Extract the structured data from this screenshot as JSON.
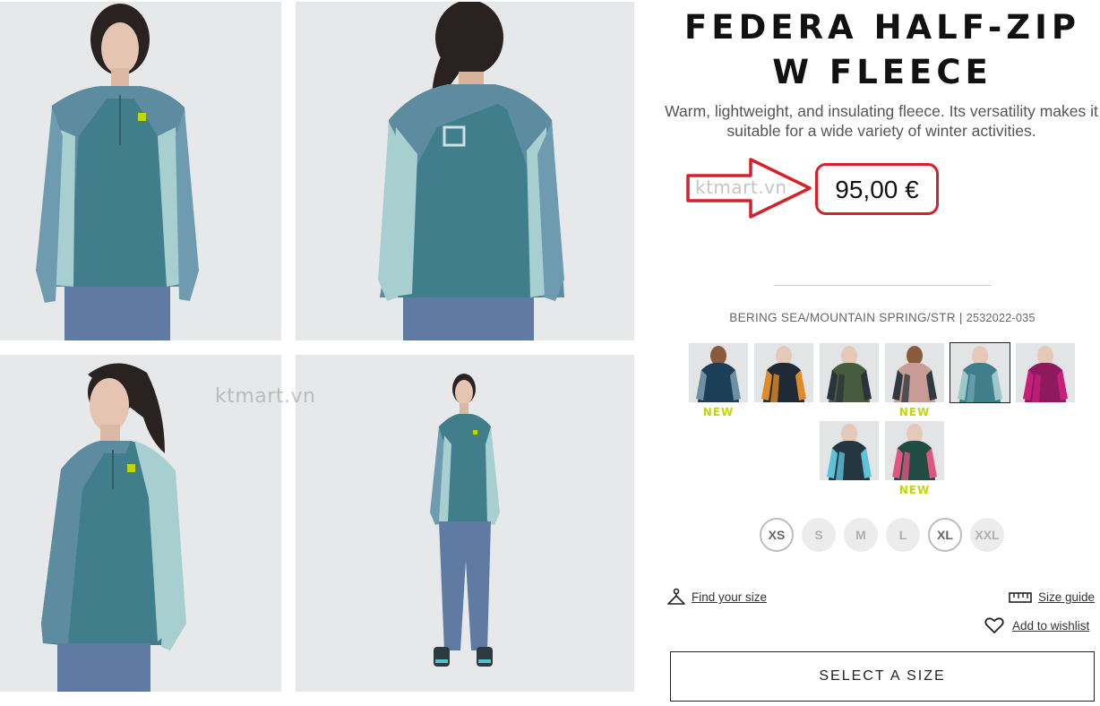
{
  "product": {
    "title": "FEDERA HALF-ZIP W FLEECE",
    "description": "Warm, lightweight, and insulating fleece. Its versatility makes it suitable for a wide variety of winter activities.",
    "price": "95,00 €",
    "variant_name": "BERING SEA/MOUNTAIN SPRING/STR |",
    "variant_code": "2532022-035"
  },
  "watermark": "ktmart.vn",
  "gallery": [
    {
      "view": "front"
    },
    {
      "view": "back"
    },
    {
      "view": "three-quarter"
    },
    {
      "view": "full-body"
    }
  ],
  "colors": {
    "swatches": [
      {
        "top": "#1c3f58",
        "side": "#6f8fa3",
        "accent": "#1c3f58",
        "skin": "#8a5a3c",
        "new": true
      },
      {
        "top": "#1e2b36",
        "side": "#e08a26",
        "accent": "#e08a26",
        "skin": "#e4c9b8",
        "new": false
      },
      {
        "top": "#465c3c",
        "side": "#2a333a",
        "accent": "#2a333a",
        "skin": "#e4c9b8",
        "new": false
      },
      {
        "top": "#c99b95",
        "side": "#2f3a40",
        "accent": "#2f3a40",
        "skin": "#8a5a3c",
        "new": true
      },
      {
        "top": "#3f7e8a",
        "side": "#9fc7c8",
        "accent": "#6ea2b2",
        "skin": "#e4c9b8",
        "new": false,
        "selected": true
      },
      {
        "top": "#8e1a5e",
        "side": "#c81f7a",
        "accent": "#c81f7a",
        "skin": "#e4c9b8",
        "new": false
      },
      {
        "top": "#253640",
        "side": "#5ec3d8",
        "accent": "#5ec3d8",
        "skin": "#e4c9b8",
        "new": false
      },
      {
        "top": "#1f4d43",
        "side": "#e0557f",
        "accent": "#e0557f",
        "skin": "#e4c9b8",
        "new": true
      }
    ],
    "new_label": "NEW",
    "new_color": "#c3d600"
  },
  "sizes": [
    {
      "label": "XS",
      "available": true
    },
    {
      "label": "S",
      "available": false
    },
    {
      "label": "M",
      "available": false
    },
    {
      "label": "L",
      "available": false
    },
    {
      "label": "XL",
      "available": true
    },
    {
      "label": "XXL",
      "available": false
    }
  ],
  "links": {
    "find_size": "Find your size",
    "size_guide": "Size guide",
    "wishlist": "Add to wishlist"
  },
  "cta": {
    "select_size": "SELECT A SIZE"
  },
  "icons": {
    "find_size": "hanger-icon",
    "size_guide": "ruler-icon",
    "wishlist": "heart-icon"
  },
  "highlight_color": "#d6202a"
}
